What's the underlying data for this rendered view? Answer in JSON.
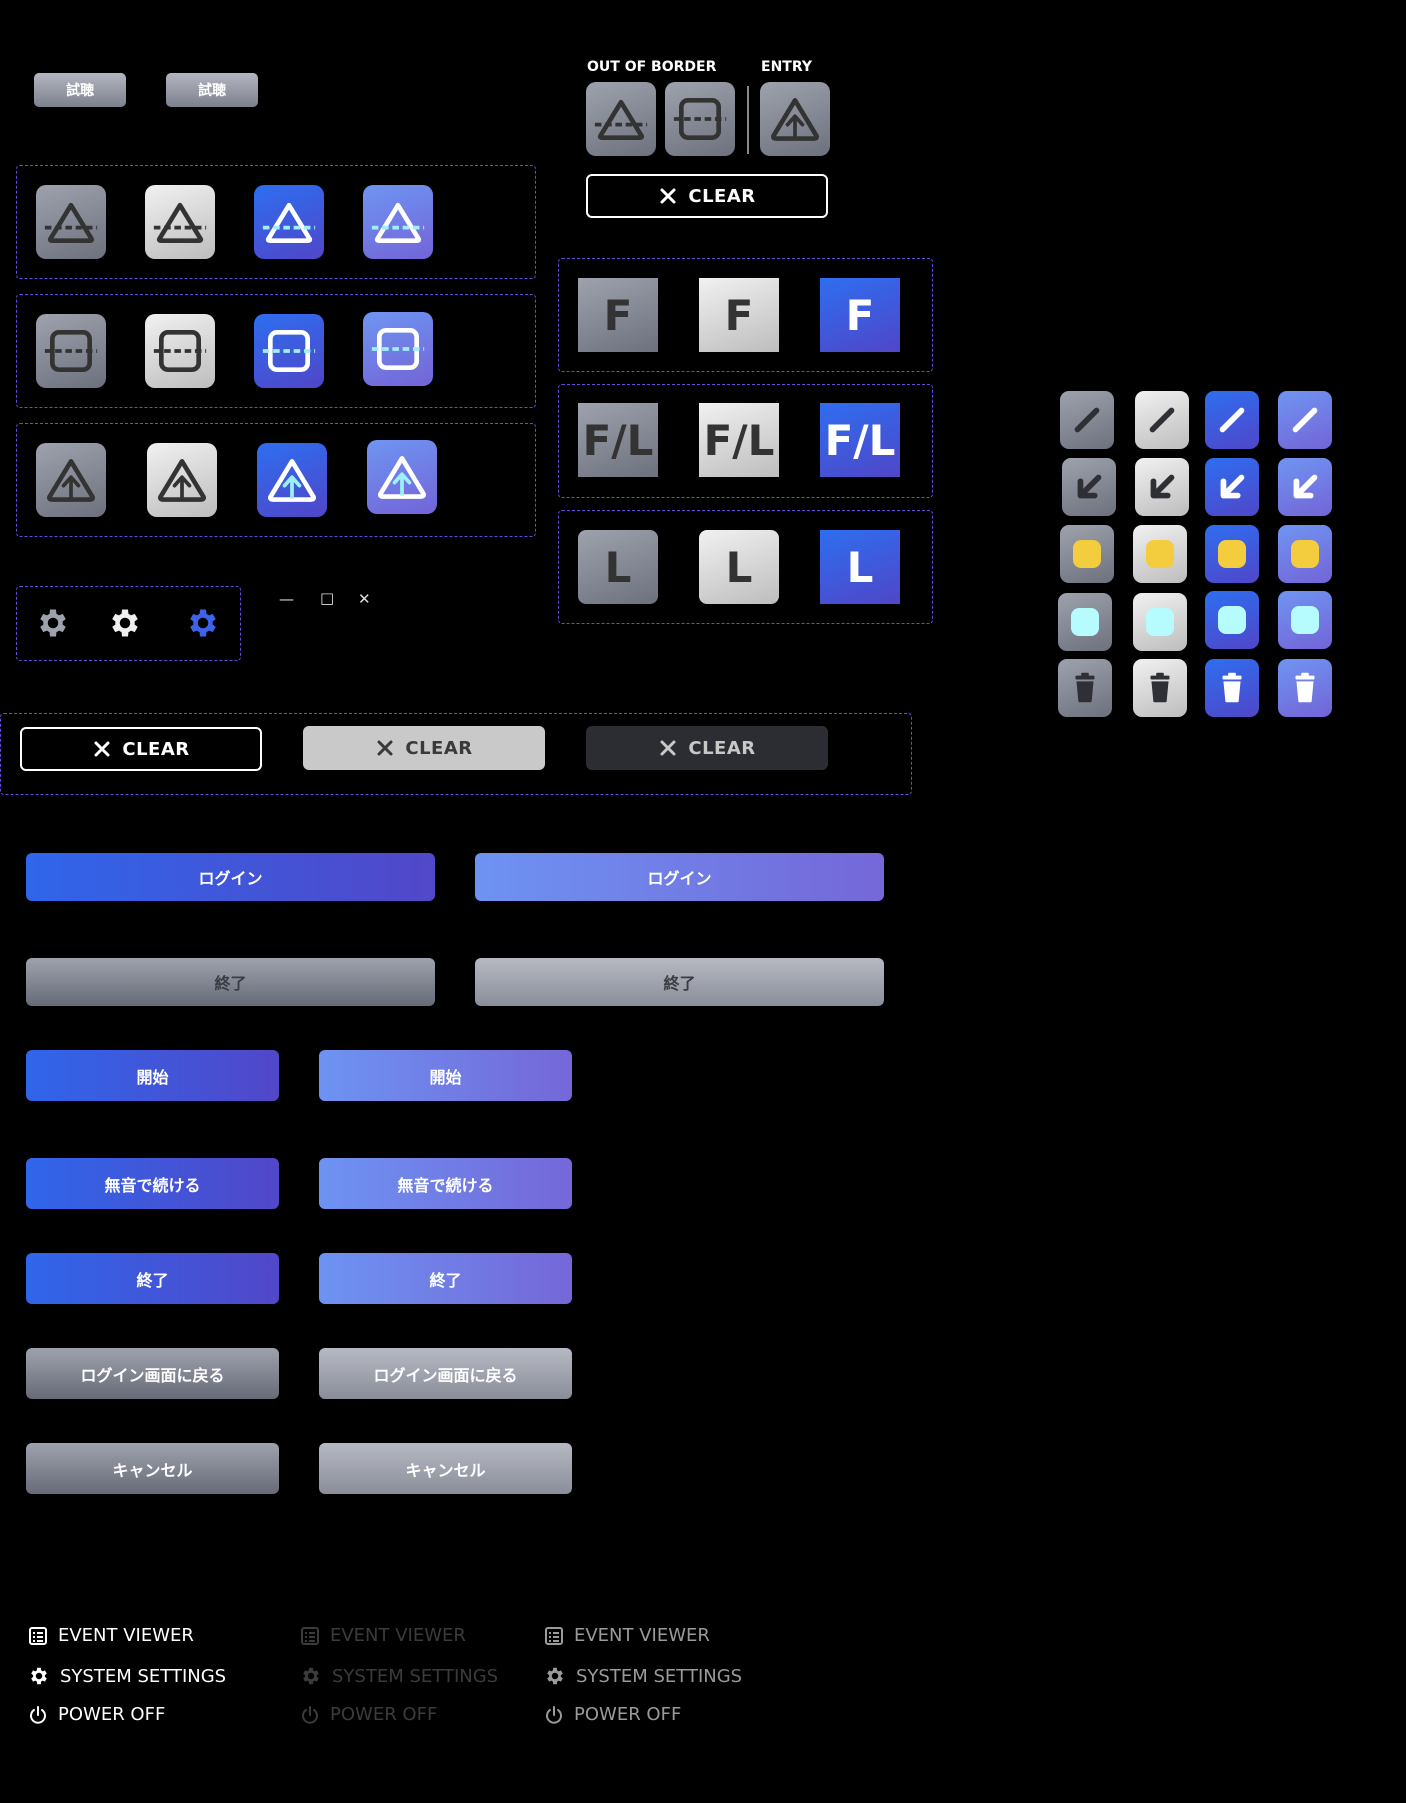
{
  "top_buttons": [
    "試聴",
    "試聴"
  ],
  "labels": {
    "out_of_border": "OUT OF BORDER",
    "entry": "ENTRY"
  },
  "clear_label": "CLEAR",
  "f_tiles": [
    "F",
    "F/L",
    "L"
  ],
  "window_controls": {
    "minimize": "—",
    "maximize": "□",
    "close": "✕"
  },
  "wide_buttons": {
    "login": "ログイン",
    "exit": "終了"
  },
  "medium_buttons": {
    "start": "開始",
    "continue_muted": "無音で続ける",
    "exit": "終了",
    "back_to_login": "ログイン画面に戻る",
    "cancel": "キャンセル"
  },
  "menu": {
    "event_viewer": "EVENT VIEWER",
    "system_settings": "SYSTEM SETTINGS",
    "power_off": "POWER OFF"
  },
  "icon_names": [
    "triangle-dashed-icon",
    "square-dashed-icon",
    "triangle-arrow-up-icon",
    "gear-icon",
    "pen-icon",
    "arrow-down-left-icon",
    "square-yellow-icon",
    "square-cyan-icon",
    "trash-icon",
    "list-icon",
    "power-icon",
    "close-icon"
  ]
}
